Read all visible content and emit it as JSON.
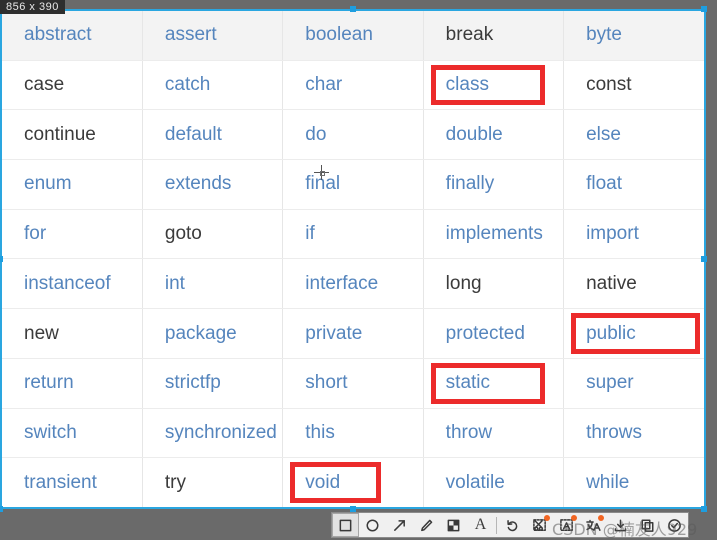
{
  "capture": {
    "size_readout": "856 x 390",
    "selection_color": "#2aa6e0",
    "marker_color": "#ec2b2b",
    "keyword_blue": "#5585bd",
    "keyword_dark": "#3b3b3b"
  },
  "table": {
    "rows": [
      [
        {
          "text": "abstract",
          "tone": "blue",
          "marked": false
        },
        {
          "text": "assert",
          "tone": "blue",
          "marked": false
        },
        {
          "text": "boolean",
          "tone": "blue",
          "marked": false
        },
        {
          "text": "break",
          "tone": "dark",
          "marked": false
        },
        {
          "text": "byte",
          "tone": "blue",
          "marked": false
        }
      ],
      [
        {
          "text": "case",
          "tone": "dark",
          "marked": false
        },
        {
          "text": "catch",
          "tone": "blue",
          "marked": false
        },
        {
          "text": "char",
          "tone": "blue",
          "marked": false
        },
        {
          "text": "class",
          "tone": "blue",
          "marked": true
        },
        {
          "text": "const",
          "tone": "dark",
          "marked": false
        }
      ],
      [
        {
          "text": "continue",
          "tone": "dark",
          "marked": false
        },
        {
          "text": "default",
          "tone": "blue",
          "marked": false
        },
        {
          "text": "do",
          "tone": "blue",
          "marked": false
        },
        {
          "text": "double",
          "tone": "blue",
          "marked": false
        },
        {
          "text": "else",
          "tone": "blue",
          "marked": false
        }
      ],
      [
        {
          "text": "enum",
          "tone": "blue",
          "marked": false
        },
        {
          "text": "extends",
          "tone": "blue",
          "marked": false
        },
        {
          "text": "final",
          "tone": "blue",
          "marked": false
        },
        {
          "text": "finally",
          "tone": "blue",
          "marked": false
        },
        {
          "text": "float",
          "tone": "blue",
          "marked": false
        }
      ],
      [
        {
          "text": "for",
          "tone": "blue",
          "marked": false
        },
        {
          "text": "goto",
          "tone": "dark",
          "marked": false
        },
        {
          "text": "if",
          "tone": "blue",
          "marked": false
        },
        {
          "text": "implements",
          "tone": "blue",
          "marked": false
        },
        {
          "text": "import",
          "tone": "blue",
          "marked": false
        }
      ],
      [
        {
          "text": "instanceof",
          "tone": "blue",
          "marked": false
        },
        {
          "text": "int",
          "tone": "blue",
          "marked": false
        },
        {
          "text": "interface",
          "tone": "blue",
          "marked": false
        },
        {
          "text": "long",
          "tone": "dark",
          "marked": false
        },
        {
          "text": "native",
          "tone": "dark",
          "marked": false
        }
      ],
      [
        {
          "text": "new",
          "tone": "dark",
          "marked": false
        },
        {
          "text": "package",
          "tone": "blue",
          "marked": false
        },
        {
          "text": "private",
          "tone": "blue",
          "marked": false
        },
        {
          "text": "protected",
          "tone": "blue",
          "marked": false
        },
        {
          "text": "public",
          "tone": "blue",
          "marked": true
        }
      ],
      [
        {
          "text": "return",
          "tone": "blue",
          "marked": false
        },
        {
          "text": "strictfp",
          "tone": "blue",
          "marked": false
        },
        {
          "text": "short",
          "tone": "blue",
          "marked": false
        },
        {
          "text": "static",
          "tone": "blue",
          "marked": true
        },
        {
          "text": "super",
          "tone": "blue",
          "marked": false
        }
      ],
      [
        {
          "text": "switch",
          "tone": "blue",
          "marked": false
        },
        {
          "text": "synchronized",
          "tone": "blue",
          "marked": false
        },
        {
          "text": "this",
          "tone": "blue",
          "marked": false
        },
        {
          "text": "throw",
          "tone": "blue",
          "marked": false
        },
        {
          "text": "throws",
          "tone": "blue",
          "marked": false
        }
      ],
      [
        {
          "text": "transient",
          "tone": "blue",
          "marked": false
        },
        {
          "text": "try",
          "tone": "dark",
          "marked": false
        },
        {
          "text": "void",
          "tone": "blue",
          "marked": true
        },
        {
          "text": "volatile",
          "tone": "blue",
          "marked": false
        },
        {
          "text": "while",
          "tone": "blue",
          "marked": false
        }
      ]
    ]
  },
  "toolbar": {
    "tools": [
      {
        "name": "rectangle-tool",
        "icon": "rectangle",
        "active": true,
        "badge": false
      },
      {
        "name": "ellipse-tool",
        "icon": "ellipse",
        "active": false,
        "badge": false
      },
      {
        "name": "arrow-tool",
        "icon": "arrow",
        "active": false,
        "badge": false
      },
      {
        "name": "pen-tool",
        "icon": "pen",
        "active": false,
        "badge": false
      },
      {
        "name": "mosaic-tool",
        "icon": "mosaic",
        "active": false,
        "badge": false
      },
      {
        "name": "text-tool",
        "icon": "letter-a",
        "active": false,
        "badge": false,
        "label": "A"
      },
      {
        "name": "separator",
        "icon": "separator",
        "active": false,
        "badge": false
      },
      {
        "name": "undo-tool",
        "icon": "undo",
        "active": false,
        "badge": false
      },
      {
        "name": "pin-cut-tool",
        "icon": "scissors",
        "active": false,
        "badge": true
      },
      {
        "name": "ocr-tool",
        "icon": "ocr",
        "active": false,
        "badge": true
      },
      {
        "name": "translate-tool",
        "icon": "translate",
        "active": false,
        "badge": true
      },
      {
        "name": "download-tool",
        "icon": "download",
        "active": false,
        "badge": false
      },
      {
        "name": "copy-tool",
        "icon": "copy",
        "active": false,
        "badge": false
      },
      {
        "name": "confirm-tool",
        "icon": "check",
        "active": false,
        "badge": false
      }
    ]
  },
  "watermark": {
    "text": "CSDN @楠友人929"
  }
}
